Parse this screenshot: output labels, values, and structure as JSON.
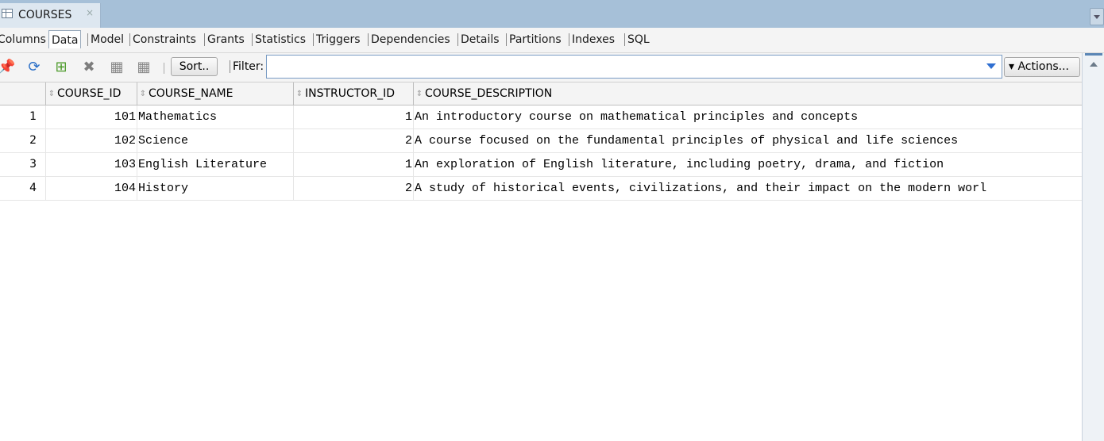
{
  "window": {
    "tab_label": "COURSES",
    "tab_close": "×"
  },
  "subtabs": [
    "Columns",
    "Data",
    "Model",
    "Constraints",
    "Grants",
    "Statistics",
    "Triggers",
    "Dependencies",
    "Details",
    "Partitions",
    "Indexes",
    "SQL"
  ],
  "active_subtab": "Data",
  "toolbar": {
    "icons": [
      "pin-icon",
      "refresh-icon",
      "insert-row-icon",
      "delete-row-icon",
      "commit-icon",
      "rollback-icon"
    ],
    "sort_label": "Sort..",
    "filter_label": "Filter:",
    "filter_value": "",
    "actions_label": "▾ Actions..."
  },
  "grid": {
    "columns": [
      "COURSE_ID",
      "COURSE_NAME",
      "INSTRUCTOR_ID",
      "COURSE_DESCRIPTION"
    ],
    "rows": [
      {
        "n": "1",
        "course_id": "101",
        "course_name": "Mathematics",
        "instructor_id": "1",
        "course_description": "An introductory course on mathematical principles and concepts"
      },
      {
        "n": "2",
        "course_id": "102",
        "course_name": "Science",
        "instructor_id": "2",
        "course_description": "A course focused on the fundamental principles of physical and life sciences"
      },
      {
        "n": "3",
        "course_id": "103",
        "course_name": "English Literature",
        "instructor_id": "1",
        "course_description": "An exploration of English literature, including poetry, drama, and fiction"
      },
      {
        "n": "4",
        "course_id": "104",
        "course_name": "History",
        "instructor_id": "2",
        "course_description": "A study of historical events, civilizations, and their impact on the modern worl"
      }
    ]
  }
}
